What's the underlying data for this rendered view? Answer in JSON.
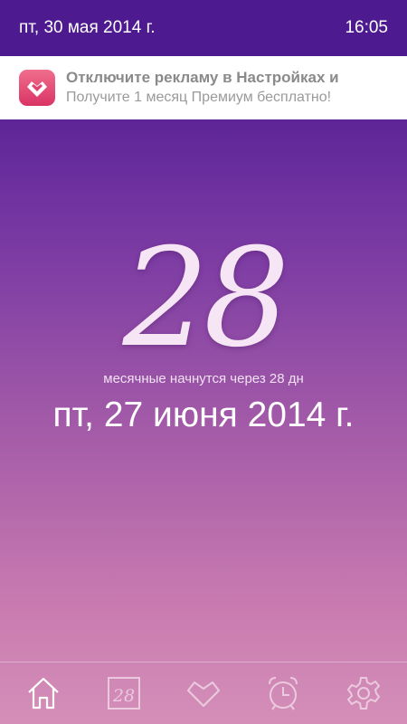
{
  "status_bar": {
    "date": "пт, 30 мая 2014 г.",
    "time": "16:05"
  },
  "ad_banner": {
    "title": "Отключите рекламу в Настройках и",
    "subtitle": "Получите 1 месяц Премиум бесплатно!",
    "icon": "heart-icon"
  },
  "main": {
    "countdown": "28",
    "caption": "месячные начнутся через 28 дн",
    "next_date": "пт, 27 июня 2014 г."
  },
  "tabs": [
    {
      "icon": "home-icon",
      "selected": true
    },
    {
      "icon": "calendar-icon",
      "label": "28",
      "selected": false
    },
    {
      "icon": "heart-icon",
      "selected": false
    },
    {
      "icon": "alarm-clock-icon",
      "selected": false
    },
    {
      "icon": "gear-icon",
      "selected": false
    }
  ],
  "colors": {
    "status_bar_bg": "#4d1b8f",
    "gradient_top": "#4c1a8e",
    "gradient_bottom": "#d48fb8",
    "ad_icon": "#e0456f"
  }
}
